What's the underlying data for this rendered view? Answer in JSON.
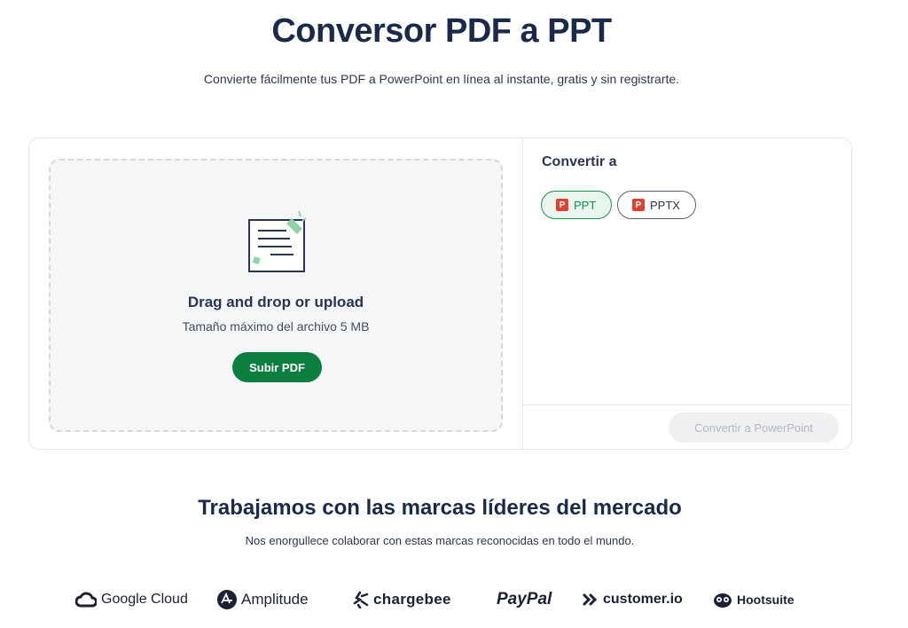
{
  "header": {
    "title": "Conversor PDF a PPT",
    "subtitle": "Convierte fácilmente tus PDF a PowerPoint en línea al instante, gratis y sin registrarte."
  },
  "upload": {
    "title": "Drag and drop or upload",
    "max_size": "Tamaño máximo del archivo 5 MB",
    "button": "Subir PDF"
  },
  "convert": {
    "label": "Convertir a",
    "formats": [
      {
        "badge": "P",
        "label": "PPT",
        "selected": true
      },
      {
        "badge": "P",
        "label": "PPTX",
        "selected": false
      }
    ],
    "button": "Convertir a PowerPoint"
  },
  "brands": {
    "title": "Trabajamos con las marcas líderes del mercado",
    "subtitle": "Nos enorgullece colaborar con estas marcas reconocidas en todo el mundo.",
    "logos": [
      "Google Cloud",
      "Amplitude",
      "chargebee",
      "PayPal",
      "customer.io",
      "Hootsuite"
    ]
  },
  "colors": {
    "primary_green": "#0c7e3e",
    "pdf_red": "#e0402f",
    "navy": "#1b2a4a"
  }
}
